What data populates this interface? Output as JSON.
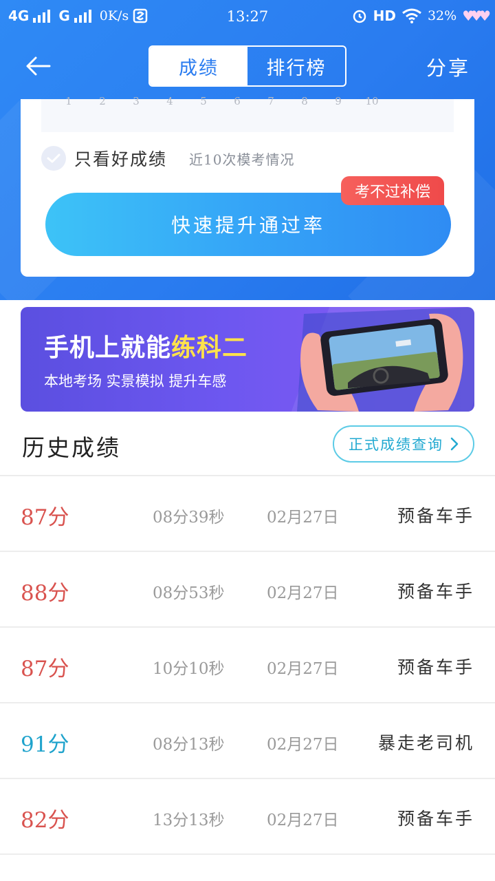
{
  "status_bar": {
    "network1": "4G",
    "network2": "G",
    "speed": "0K/s",
    "time": "13:27",
    "hd": "HD",
    "battery": "32%"
  },
  "nav": {
    "tabs": [
      "成绩",
      "排行榜"
    ],
    "active_tab": 0,
    "share": "分享"
  },
  "chart_axis": {
    "ticks": [
      "1",
      "2",
      "3",
      "4",
      "5",
      "6",
      "7",
      "8",
      "9",
      "10"
    ]
  },
  "filter": {
    "label": "只看好成绩",
    "hint": "近10次模考情况"
  },
  "boost": {
    "button_label": "快速提升通过率",
    "badge": "考不过补偿"
  },
  "banner": {
    "title_main": "手机上就能",
    "title_highlight": "练科二",
    "subtitle": "本地考场 实景模拟 提升车感"
  },
  "history": {
    "title": "历史成绩",
    "query_button": "正式成绩查询",
    "rows": [
      {
        "score": "87分",
        "duration": "08分39秒",
        "date": "02月27日",
        "rank": "预备车手",
        "color": "#d9534f"
      },
      {
        "score": "88分",
        "duration": "08分53秒",
        "date": "02月27日",
        "rank": "预备车手",
        "color": "#d9534f"
      },
      {
        "score": "87分",
        "duration": "10分10秒",
        "date": "02月27日",
        "rank": "预备车手",
        "color": "#d9534f"
      },
      {
        "score": "91分",
        "duration": "08分13秒",
        "date": "02月27日",
        "rank": "暴走老司机",
        "color": "#1fa3cc"
      },
      {
        "score": "82分",
        "duration": "13分13秒",
        "date": "02月27日",
        "rank": "预备车手",
        "color": "#d9534f"
      }
    ]
  },
  "colors": {
    "header_blue": "#2a7cf0",
    "accent_cyan": "#22a9d1",
    "score_red": "#d9534f",
    "score_blue": "#1fa3cc",
    "badge_red": "#ef4a4a",
    "banner_purple": "#6d57f0",
    "banner_highlight": "#ffe24a"
  }
}
